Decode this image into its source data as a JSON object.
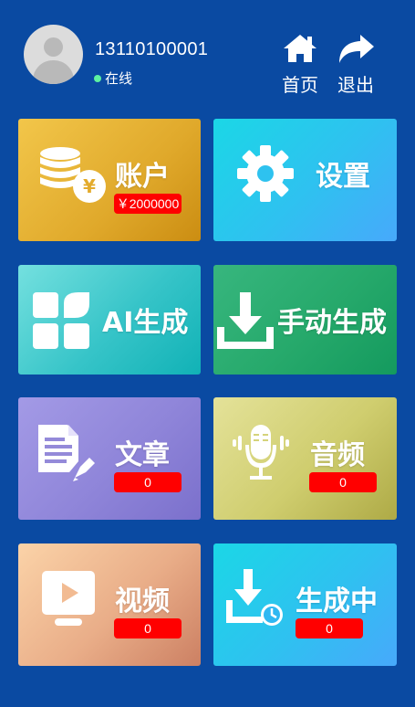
{
  "user": {
    "phone": "13110100001",
    "status": "在线"
  },
  "nav": {
    "home_label": "首页",
    "logout_label": "退出"
  },
  "tiles": {
    "account": {
      "title": "账户",
      "badge": "￥2000000"
    },
    "settings": {
      "title": "设置"
    },
    "ai": {
      "title": "AI生成"
    },
    "manual": {
      "title": "手动生成"
    },
    "article": {
      "title": "文章",
      "badge": "0"
    },
    "audio": {
      "title": "音频",
      "badge": "0"
    },
    "video": {
      "title": "视频",
      "badge": "0"
    },
    "generating": {
      "title": "生成中",
      "badge": "0"
    }
  },
  "colors": {
    "background": "#0a4aa2",
    "badge": "#ff0000",
    "online_dot": "#5df2a0"
  }
}
